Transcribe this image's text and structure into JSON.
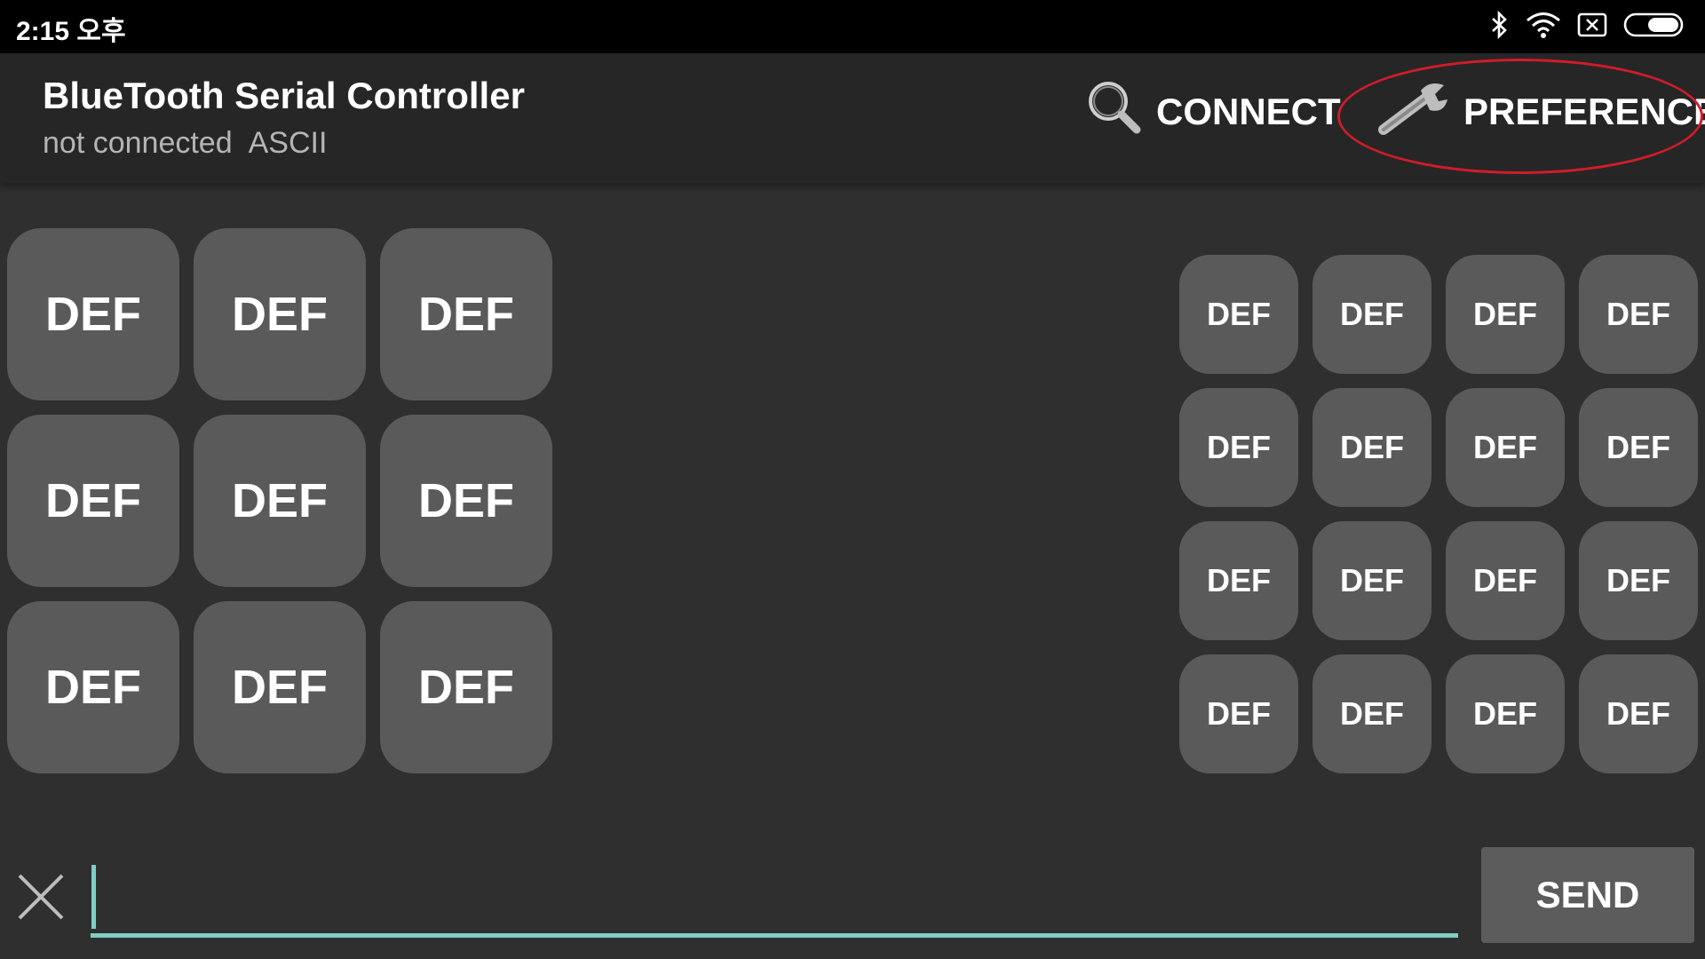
{
  "status_bar": {
    "time": "2:15 오후",
    "icons": [
      "bluetooth-icon",
      "wifi-icon",
      "notification-x-icon",
      "battery-icon"
    ]
  },
  "app_bar": {
    "title": "BlueTooth Serial Controller",
    "connection_status": "not connected",
    "mode": "ASCII",
    "connect_label": "CONNECT",
    "preference_label": "PREFERENCE",
    "highlight_color": "#d01c2a"
  },
  "left_pad": {
    "buttons": [
      "DEF",
      "DEF",
      "DEF",
      "DEF",
      "DEF",
      "DEF",
      "DEF",
      "DEF",
      "DEF"
    ]
  },
  "right_pad": {
    "buttons": [
      "DEF",
      "DEF",
      "DEF",
      "DEF",
      "DEF",
      "DEF",
      "DEF",
      "DEF",
      "DEF",
      "DEF",
      "DEF",
      "DEF",
      "DEF",
      "DEF",
      "DEF",
      "DEF"
    ]
  },
  "input_row": {
    "value": "",
    "send_label": "SEND",
    "accent_color": "#7fcfc2"
  },
  "colors": {
    "background": "#2f2f2f",
    "app_bar": "#262626",
    "button": "#5a5a5a"
  }
}
